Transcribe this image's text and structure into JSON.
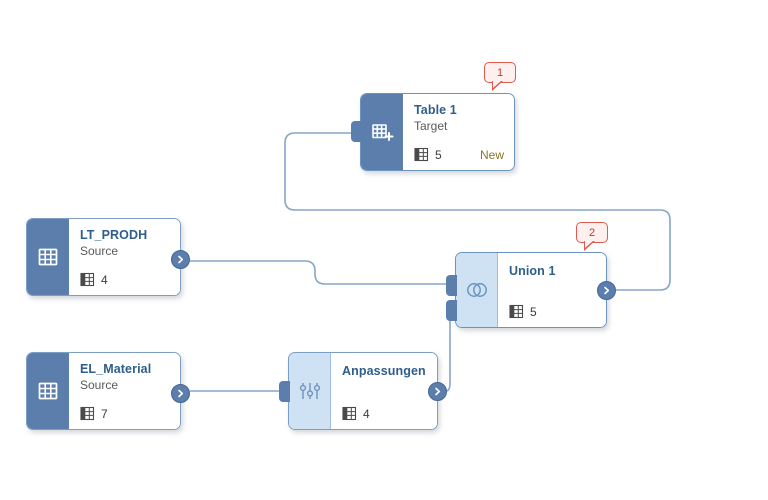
{
  "canvas": {
    "background": "#ffffff",
    "accent": "#5b7ead",
    "edge_color": "#86a6c8",
    "title_color": "#2f5d8c",
    "badge_color": "#e05a4e",
    "status_color": "#8a7327"
  },
  "nodes": [
    {
      "id": "table1",
      "title": "Table 1",
      "subtitle": "Target",
      "count": "5",
      "status": "New",
      "icon": "table-plus-icon",
      "panel_style": "dark",
      "badge": "1"
    },
    {
      "id": "lt_prodh",
      "title": "LT_PRODH",
      "subtitle": "Source",
      "count": "4",
      "status": "",
      "icon": "table-grid-icon",
      "panel_style": "dark",
      "badge": ""
    },
    {
      "id": "union1",
      "title": "Union 1",
      "subtitle": "",
      "count": "5",
      "status": "",
      "icon": "union-circles-icon",
      "panel_style": "light",
      "badge": "2"
    },
    {
      "id": "el_material",
      "title": "EL_Material",
      "subtitle": "Source",
      "count": "7",
      "status": "",
      "icon": "table-grid-icon",
      "panel_style": "dark",
      "badge": ""
    },
    {
      "id": "anpassungen",
      "title": "Anpassungen",
      "subtitle": "",
      "count": "4",
      "status": "",
      "icon": "sliders-icon",
      "panel_style": "light",
      "badge": ""
    }
  ]
}
